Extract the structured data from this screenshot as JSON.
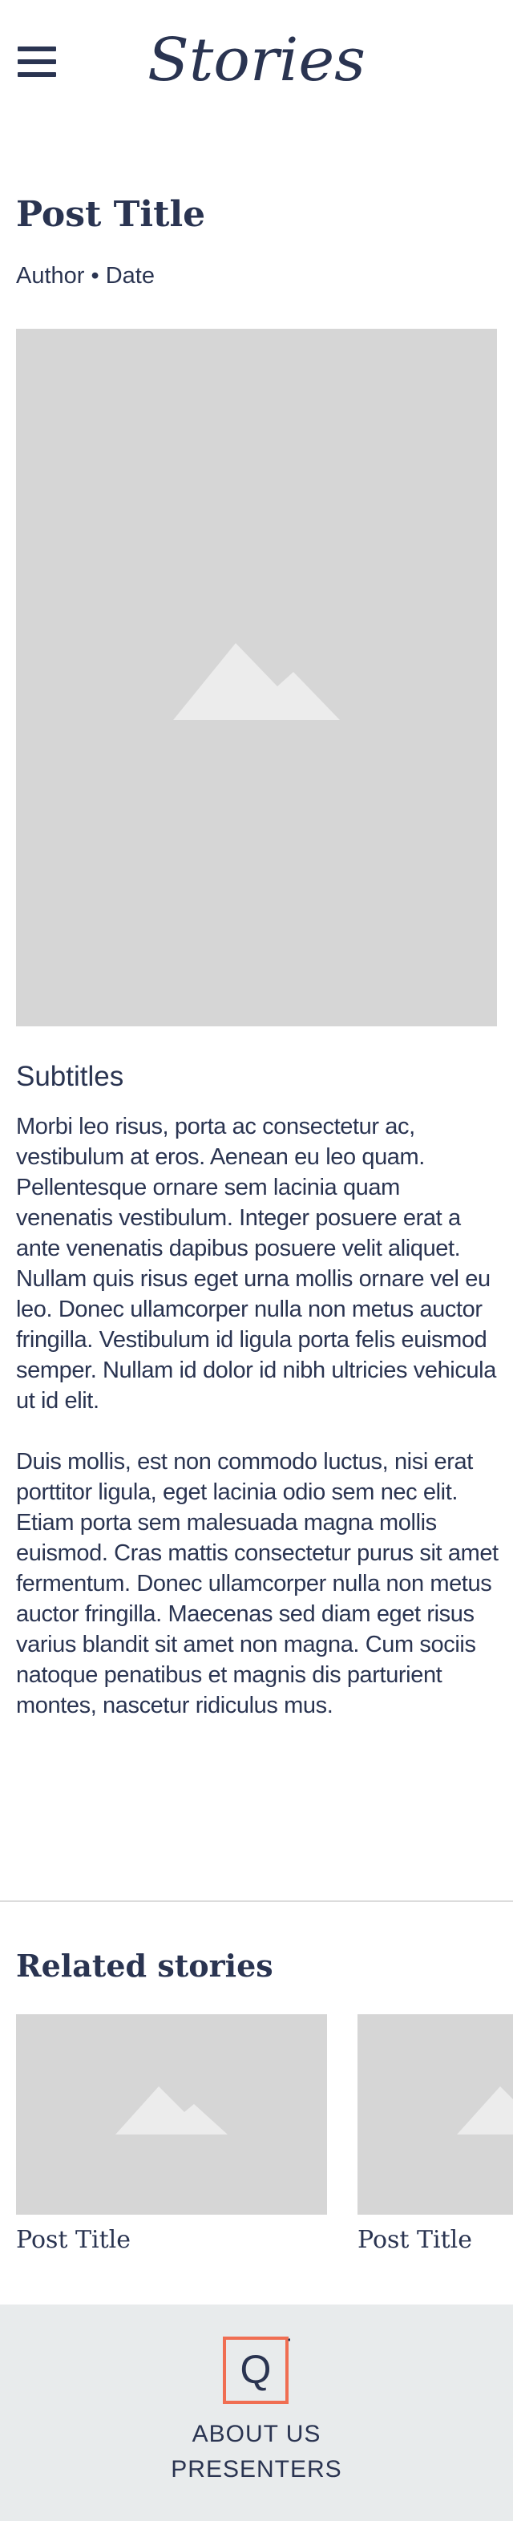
{
  "header": {
    "menu_icon": "hamburger-menu-icon",
    "logo_text": "Stories"
  },
  "post": {
    "title": "Post Title",
    "meta": "Author • Date",
    "hero_image_icon": "image-placeholder-icon",
    "subtitle": "Subtitles",
    "paragraphs": [
      "Morbi leo risus, porta ac consectetur ac, vestibulum at eros. Aenean eu leo quam. Pellentesque ornare sem lacinia quam venenatis vestibulum. Integer posuere erat a ante venenatis dapibus posuere velit aliquet. Nullam quis risus eget urna mollis ornare vel eu leo. Donec ullamcorper nulla non metus auctor fringilla. Vestibulum id ligula porta felis euismod semper. Nullam id dolor id nibh ultricies vehicula ut id elit.",
      "Duis mollis, est non commodo luctus, nisi erat porttitor ligula, eget lacinia odio sem nec elit. Etiam porta sem malesuada magna mollis euismod. Cras mattis consectetur purus sit amet fermentum. Donec ullamcorper nulla non metus auctor fringilla. Maecenas sed diam eget risus varius blandit sit amet non magna. Cum sociis natoque penatibus et magnis dis parturient montes, nascetur ridiculus mus."
    ]
  },
  "related": {
    "heading": "Related stories",
    "items": [
      {
        "title": "Post Title"
      },
      {
        "title": "Post Title"
      }
    ]
  },
  "footer": {
    "logo_letter": "Q",
    "links": [
      "ABOUT US",
      "PRESENTERS"
    ]
  },
  "colors": {
    "text": "#2a3451",
    "placeholder": "#d6d6d6",
    "footer_bg": "#e8ebec",
    "footer_logo_accent": "#f06e52"
  }
}
